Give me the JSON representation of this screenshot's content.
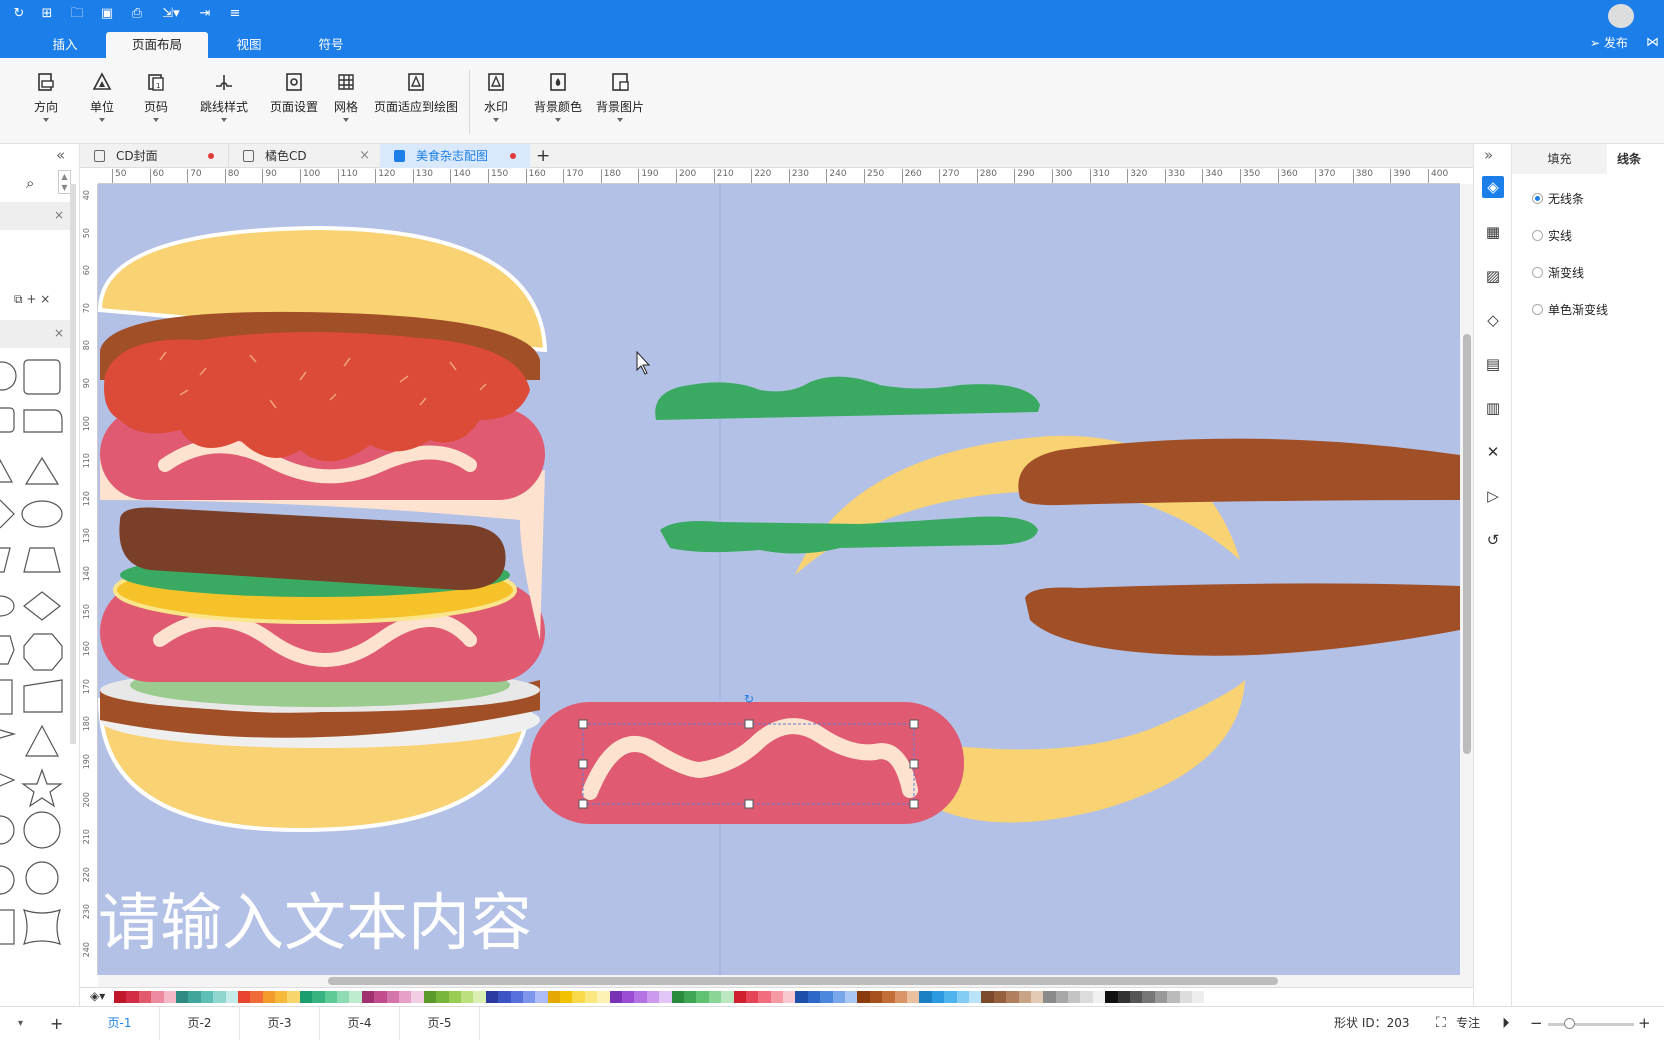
{
  "menu": {
    "tabs": [
      "插入",
      "页面布局",
      "视图",
      "符号"
    ],
    "active": 1,
    "publish": "发布"
  },
  "ribbon": {
    "buttons": [
      "方向",
      "单位",
      "页码",
      "跳线样式",
      "页面设置",
      "网格",
      "页面适应到绘图",
      "水印",
      "背景颜色",
      "背景图片"
    ]
  },
  "doc_tabs": [
    {
      "title": "CD封面",
      "state": "modified"
    },
    {
      "title": "橘色CD",
      "state": "close"
    },
    {
      "title": "美食杂志配图",
      "state": "active"
    }
  ],
  "rulers": {
    "h": [
      "50",
      "60",
      "70",
      "80",
      "90",
      "100",
      "110",
      "120",
      "130",
      "140",
      "150",
      "160",
      "170",
      "180",
      "190",
      "200",
      "210",
      "220",
      "230",
      "240",
      "250",
      "260",
      "270",
      "280",
      "290",
      "300",
      "310",
      "320",
      "330",
      "340",
      "350",
      "360",
      "370",
      "380",
      "390",
      "400"
    ],
    "v": [
      "40",
      "50",
      "60",
      "70",
      "80",
      "90",
      "100",
      "110",
      "120",
      "130",
      "140",
      "150",
      "160",
      "170",
      "180",
      "190",
      "200",
      "210",
      "220",
      "230",
      "240"
    ]
  },
  "canvas": {
    "placeholder_text": "请输入文本内容",
    "background": "#b3c1e6"
  },
  "right_panel": {
    "tabs": [
      "填充",
      "线条"
    ],
    "options": [
      "无线条",
      "实线",
      "渐变线",
      "单色渐变线"
    ],
    "selected": 0
  },
  "page_tabs": [
    "页-1",
    "页-2",
    "页-3",
    "页-4",
    "页-5"
  ],
  "status": {
    "shape_id": "形状 ID：203",
    "focus": "专注"
  },
  "colors": {
    "accent": "#1c7ee8",
    "canvas": "#b3c1e6",
    "bun": "#f8d273",
    "patty": "#a14f27",
    "lettuce": "#3aaa62",
    "ham": "#e05a72",
    "cream": "#fde3cf"
  }
}
